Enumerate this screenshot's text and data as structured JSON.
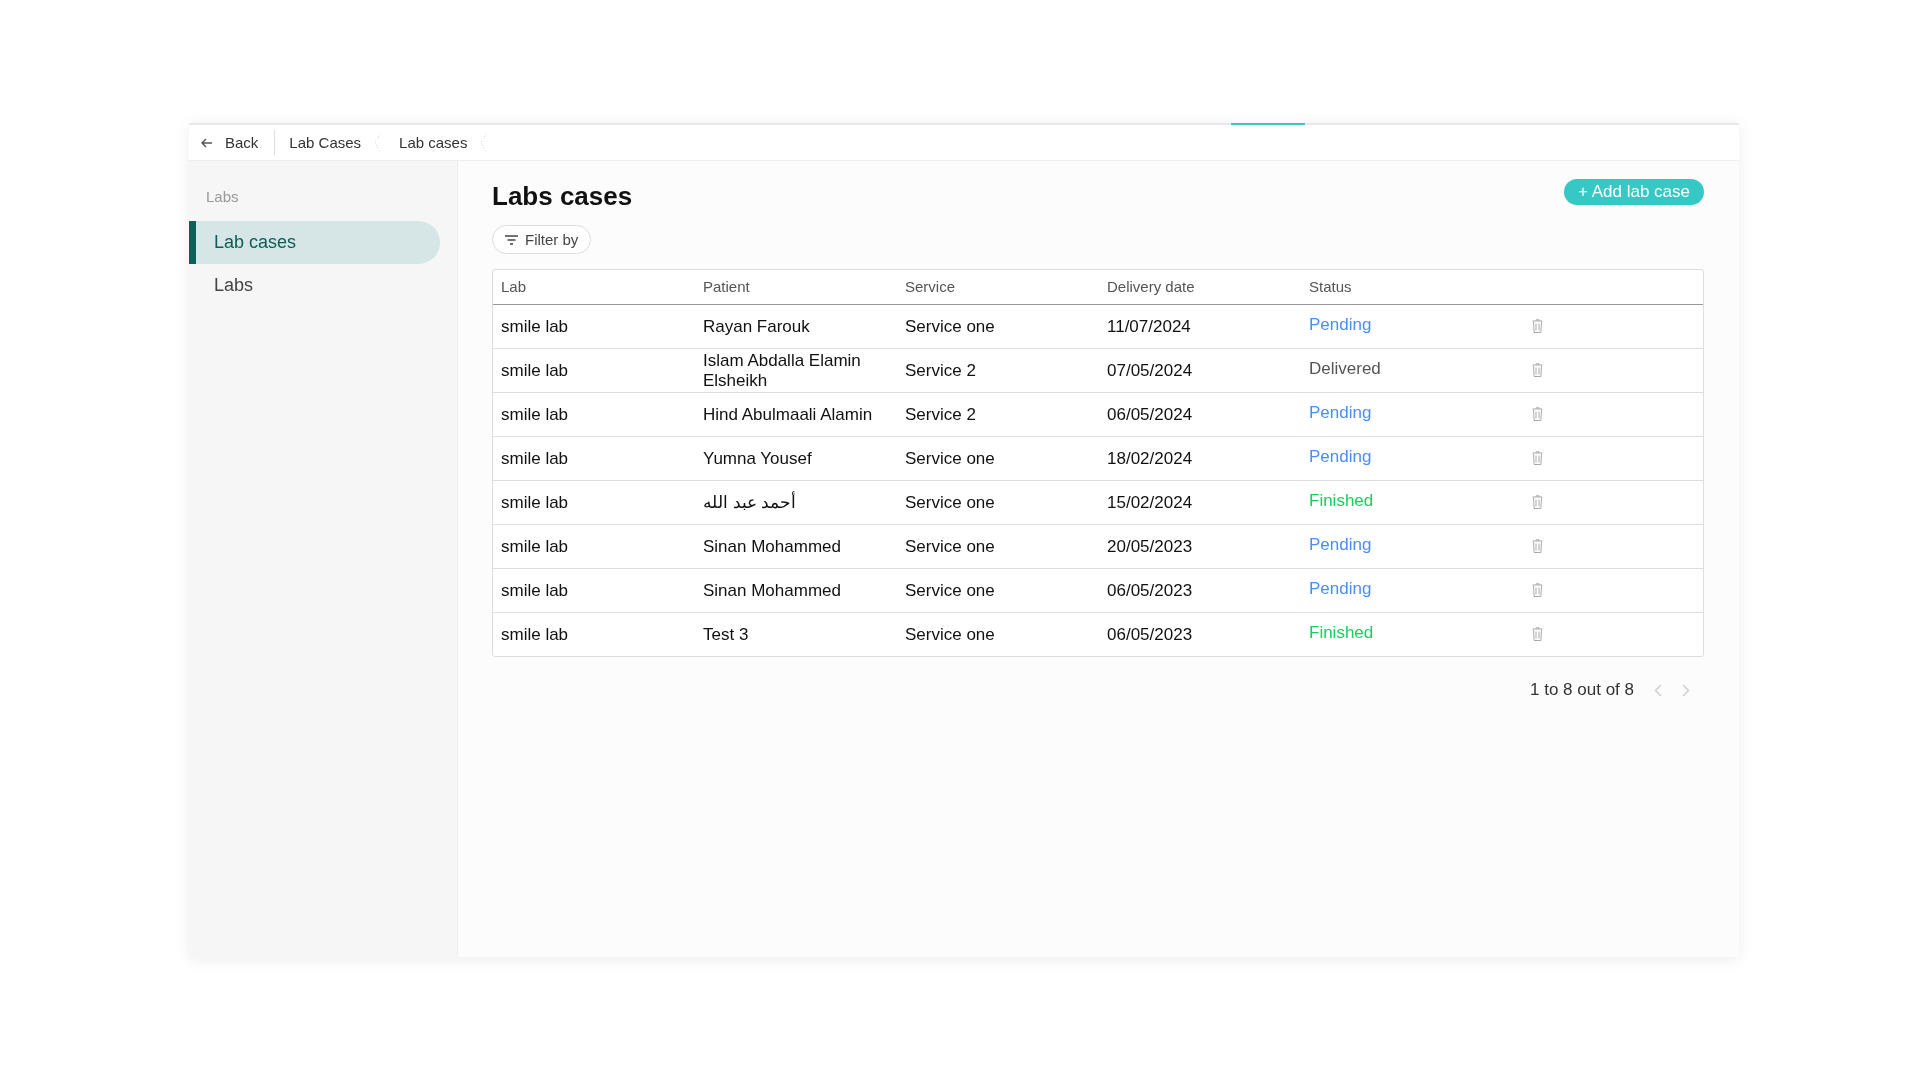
{
  "breadcrumb": {
    "back": "Back",
    "items": [
      "Lab Cases",
      "Lab cases"
    ]
  },
  "sidebar": {
    "heading": "Labs",
    "items": [
      {
        "label": "Lab cases",
        "selected": true
      },
      {
        "label": "Labs",
        "selected": false
      }
    ]
  },
  "page": {
    "title": "Labs cases",
    "add_button": "+ Add lab case",
    "filter_button": "Filter by"
  },
  "table": {
    "columns": [
      "Lab",
      "Patient",
      "Service",
      "Delivery date",
      "Status"
    ],
    "rows": [
      {
        "lab": "smile lab",
        "patient": "Rayan Farouk",
        "service": "Service one",
        "date": "11/07/2024",
        "status": "Pending",
        "kind": "pending"
      },
      {
        "lab": "smile lab",
        "patient": "Islam Abdalla Elamin Elsheikh",
        "service": "Service 2",
        "date": "07/05/2024",
        "status": "Delivered",
        "kind": "delivered"
      },
      {
        "lab": "smile lab",
        "patient": "Hind Abulmaali Alamin",
        "service": "Service 2",
        "date": "06/05/2024",
        "status": "Pending",
        "kind": "pending"
      },
      {
        "lab": "smile lab",
        "patient": "Yumna Yousef",
        "service": "Service one",
        "date": "18/02/2024",
        "status": "Pending",
        "kind": "pending"
      },
      {
        "lab": "smile lab",
        "patient": "أحمد عبد الله",
        "service": "Service one",
        "date": "15/02/2024",
        "status": "Finished",
        "kind": "finished"
      },
      {
        "lab": "smile lab",
        "patient": "Sinan Mohammed",
        "service": "Service one",
        "date": "20/05/2023",
        "status": "Pending",
        "kind": "pending"
      },
      {
        "lab": "smile lab",
        "patient": "Sinan Mohammed",
        "service": "Service one",
        "date": "06/05/2023",
        "status": "Pending",
        "kind": "pending"
      },
      {
        "lab": "smile lab",
        "patient": "Test 3",
        "service": "Service one",
        "date": "06/05/2023",
        "status": "Finished",
        "kind": "finished"
      }
    ]
  },
  "pagination": {
    "summary": "1 to 8 out of 8",
    "prev_disabled": true,
    "next_disabled": true
  }
}
